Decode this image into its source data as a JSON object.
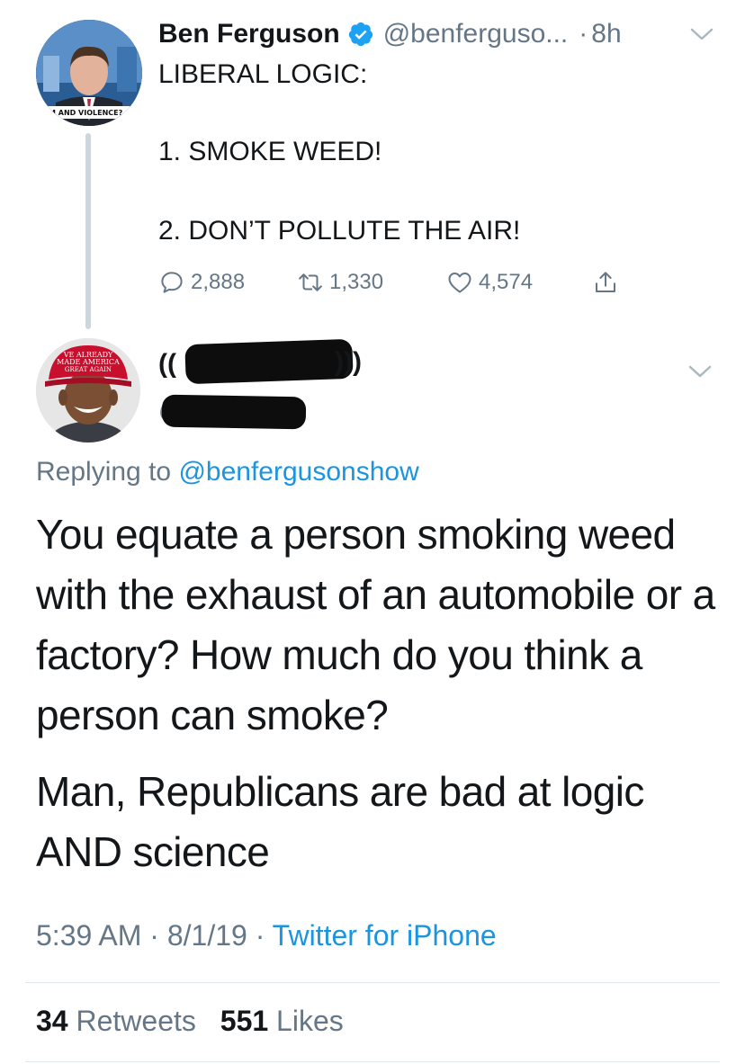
{
  "parent_tweet": {
    "display_name": "Ben Ferguson",
    "handle": "@benferguso...",
    "time": "8h",
    "verified_icon": "verified-badge-icon",
    "avatar_caption": "M AND VIOLENCE?",
    "text_line_1": "LIBERAL LOGIC:",
    "text_line_2": "1. SMOKE WEED!",
    "text_line_3": "2. DON’T POLLUTE THE AIR!",
    "actions": {
      "replies": "2,888",
      "retweets": "1,330",
      "likes": "4,574"
    }
  },
  "reply_tweet": {
    "display_name_prefix": "((",
    "display_name_suffix": ")))",
    "handle_prefix": "@",
    "avatar_hat_text": [
      "VE ALREADY",
      "MADE AMERICA",
      "GREAT AGAIN"
    ],
    "replying_label": "Replying to",
    "replying_to": "@benfergusonshow",
    "paragraph_1": "You equate a person smoking weed with the exhaust of an automobile or a factory? How much do you think a person can smoke?",
    "paragraph_2": "Man, Republicans are bad at logic AND science",
    "timestamp": "5:39 AM · 8/1/19 ·",
    "source": "Twitter for iPhone",
    "retweet_count": "34",
    "retweet_label": "Retweets",
    "like_count": "551",
    "like_label": "Likes"
  },
  "colors": {
    "text": "#14171a",
    "secondary": "#657786",
    "link": "#1b95e0",
    "verified": "#1da1f2",
    "thread_line": "#ccd6dd",
    "divider": "#e1e8ed"
  }
}
